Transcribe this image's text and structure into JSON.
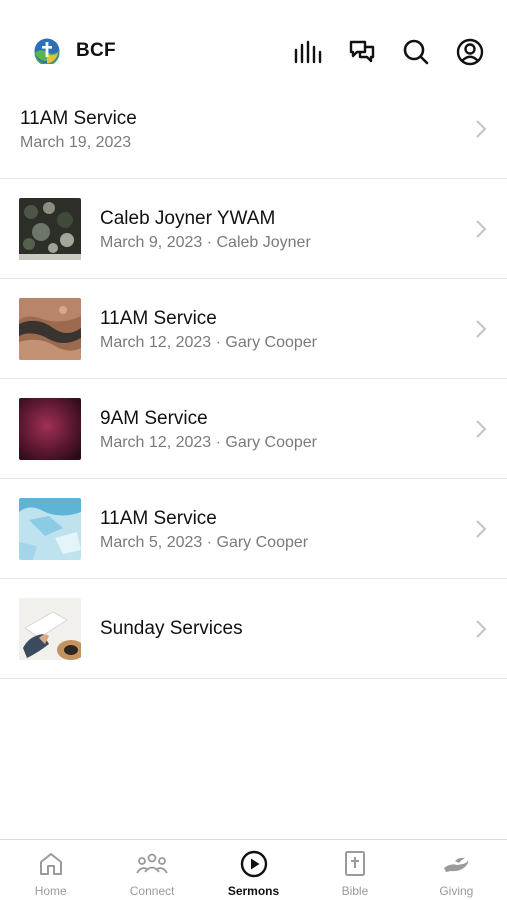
{
  "header": {
    "brand_name": "BCF"
  },
  "sermons": [
    {
      "title": "11AM Service",
      "subtitle": "March 19, 2023",
      "thumb": "none"
    },
    {
      "title": "Caleb Joyner YWAM",
      "subtitle": "March 9, 2023 · Caleb Joyner",
      "thumb": "dark-foliage"
    },
    {
      "title": "11AM Service",
      "subtitle": "March 12, 2023 · Gary Cooper",
      "thumb": "canyon"
    },
    {
      "title": "9AM Service",
      "subtitle": "March 12, 2023 · Gary Cooper",
      "thumb": "crimson"
    },
    {
      "title": "11AM Service",
      "subtitle": "March 5, 2023 · Gary Cooper",
      "thumb": "ice-blue"
    },
    {
      "title": "Sunday Services",
      "subtitle": "",
      "thumb": "bible-hat"
    }
  ],
  "tabbar": {
    "tabs": [
      {
        "label": "Home",
        "icon": "home-icon",
        "active": false
      },
      {
        "label": "Connect",
        "icon": "people-icon",
        "active": false
      },
      {
        "label": "Sermons",
        "icon": "play-circle-icon",
        "active": true
      },
      {
        "label": "Bible",
        "icon": "bible-icon",
        "active": false
      },
      {
        "label": "Giving",
        "icon": "giving-hand-icon",
        "active": false
      }
    ]
  },
  "colors": {
    "active_tab": "#111111",
    "inactive_tab": "#9a9a9a",
    "subtitle": "#7a7a7a",
    "divider": "#e6e6e6"
  }
}
